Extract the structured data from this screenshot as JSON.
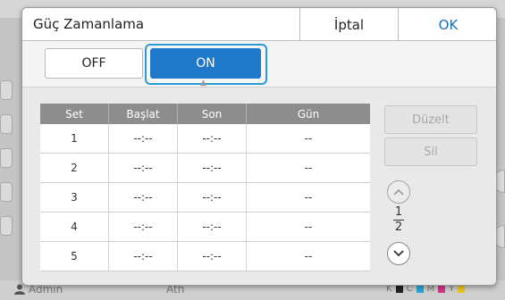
{
  "dialog": {
    "title": "Güç Zamanlama",
    "cancel_label": "İptal",
    "ok_label": "OK"
  },
  "toggle": {
    "off_label": "OFF",
    "on_label": "ON",
    "selected": "ON"
  },
  "table": {
    "headers": [
      "Set",
      "Başlat",
      "Son",
      "Gün"
    ],
    "rows": [
      [
        "1",
        "--:--",
        "--:--",
        "--"
      ],
      [
        "2",
        "--:--",
        "--:--",
        "--"
      ],
      [
        "3",
        "--:--",
        "--:--",
        "--"
      ],
      [
        "4",
        "--:--",
        "--:--",
        "--"
      ],
      [
        "5",
        "--:--",
        "--:--",
        "--"
      ]
    ]
  },
  "actions": {
    "edit_label": "Düzelt",
    "delete_label": "Sil"
  },
  "pager": {
    "current": "1",
    "total": "2"
  },
  "footer": {
    "user_label": "Admin",
    "mid_label": "Ath",
    "toner_labels": [
      "K",
      "C",
      "M",
      "Y"
    ]
  },
  "colors": {
    "accent": "#1f78c9",
    "highlight": "#2a9ad6",
    "ok_text": "#1e6fb8"
  },
  "icons": {
    "page_up": "chevron-up-icon",
    "page_down": "chevron-down-icon",
    "user": "user-icon"
  }
}
